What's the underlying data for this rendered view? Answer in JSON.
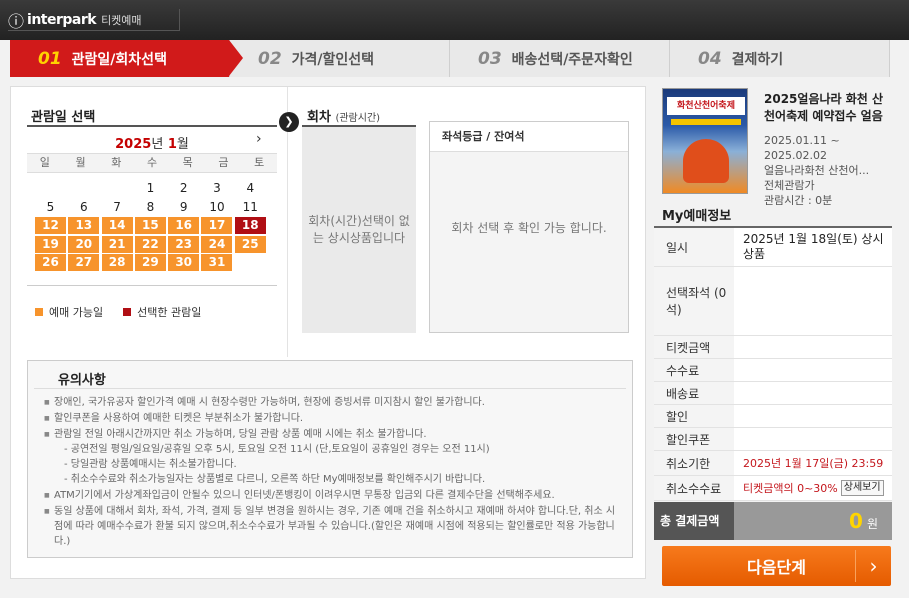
{
  "brand": {
    "mark": "ⓘ",
    "name": "interpark",
    "service": "티켓예매"
  },
  "steps": [
    {
      "num": "01",
      "label": "관람일/회차선택",
      "active": true
    },
    {
      "num": "02",
      "label": "가격/할인선택"
    },
    {
      "num": "03",
      "label": "배송선택/주문자확인"
    },
    {
      "num": "04",
      "label": "결제하기"
    }
  ],
  "calendar": {
    "title": "관람일 선택",
    "year": "2025",
    "year_suffix": "년",
    "month": "1",
    "month_suffix": "월",
    "next": "›",
    "weekdays": [
      "일",
      "월",
      "화",
      "수",
      "목",
      "금",
      "토"
    ],
    "weeks": [
      [
        "",
        "",
        "",
        "1",
        "2",
        "3",
        "4"
      ],
      [
        "5",
        "6",
        "7",
        "8",
        "9",
        "10",
        "11"
      ],
      [
        "12",
        "13",
        "14",
        "15",
        "16",
        "17",
        "18"
      ],
      [
        "19",
        "20",
        "21",
        "22",
        "23",
        "24",
        "25"
      ],
      [
        "26",
        "27",
        "28",
        "29",
        "30",
        "31",
        ""
      ]
    ],
    "available_days": [
      "12",
      "13",
      "14",
      "15",
      "16",
      "17",
      "19",
      "20",
      "21",
      "22",
      "23",
      "24",
      "25",
      "26",
      "27",
      "28",
      "29",
      "30",
      "31"
    ],
    "selected_day": "18",
    "legend_available": "예매 가능일",
    "legend_selected": "선택한 관람일",
    "color_available": "#f7942c",
    "color_selected": "#b00e14"
  },
  "round": {
    "title": "회차",
    "title_sub": "(관람시간)",
    "message": "회차(시간)선택이 없는 상시상품입니다"
  },
  "seats": {
    "title": "좌석등급 / 잔여석",
    "message": "회차 선택 후 확인 가능 합니다."
  },
  "notice": {
    "title": "유의사항",
    "items": [
      "장애인, 국가유공자 할인가격 예매 시 현장수령만 가능하며, 현장에 증빙서류 미지참시 할인 불가합니다.",
      "할인쿠폰을 사용하여 예매한 티켓은 부분취소가 불가합니다.",
      "관람일 전일 아래시간까지만 취소 가능하며, 당일 관람 상품 예매 시에는 취소 불가합니다.",
      "ATM기기에서 가상계좌입금이 안될수 있으니 인터넷/폰뱅킹이 이려우시면 무통장 입금외 다른 결제수단을 선택해주세요.",
      "동일 상품에 대해서 회차, 좌석, 가격, 결제 등 일부 변경을 원하시는 경우, 기존 예매 건을 취소하시고 재예매 하셔야 합니다.단, 취소 시점에 따라 예매수수료가 환불 되지 않으며,취소수수료가 부과될 수 있습니다.(할인은 재예매 시점에 적용되는 할인률로만 적용 가능합니다.)"
    ],
    "sub_items": [
      "- 공연전일 평일/일요일/공휴일 오후 5시, 토요일 오전 11시 (단,토요일이 공휴일인 경우는 오전 11시)",
      "- 당일관람 상품예매시는 취소불가합니다.",
      "- 취소수수료와 취소가능일자는 상품별로 다르니, 오른쪽 하단 My예매정보를 확인해주시기 바랍니다."
    ]
  },
  "event": {
    "poster_text": "화천산천어축제",
    "title": "2025얼음나라 화천 산천어축제 예약접수 얼음",
    "period": "2025.01.11 ~ 2025.02.02",
    "venue": "얼음나라화천 산천어...",
    "age": "전체관람가",
    "runtime": "관람시간 : 0분"
  },
  "my": {
    "title": "My예매정보",
    "rows": [
      {
        "key": "일시",
        "value": "2025년 1월 18일(토) 상시상품"
      },
      {
        "key": "선택좌석 (0석)",
        "value": ""
      },
      {
        "key": "티켓금액",
        "value": ""
      },
      {
        "key": "수수료",
        "value": ""
      },
      {
        "key": "배송료",
        "value": ""
      },
      {
        "key": "할인",
        "value": ""
      },
      {
        "key": "할인쿠폰",
        "value": ""
      },
      {
        "key": "취소기한",
        "value": "2025년 1월 17일(금) 23:59"
      },
      {
        "key": "취소수수료",
        "value": "티켓금액의 0~30%"
      }
    ],
    "detail_btn": "상세보기",
    "total_label": "총 결제금액",
    "total_amount": "0",
    "total_unit": "원"
  },
  "next_button": "다음단계",
  "next_chevron": "›"
}
